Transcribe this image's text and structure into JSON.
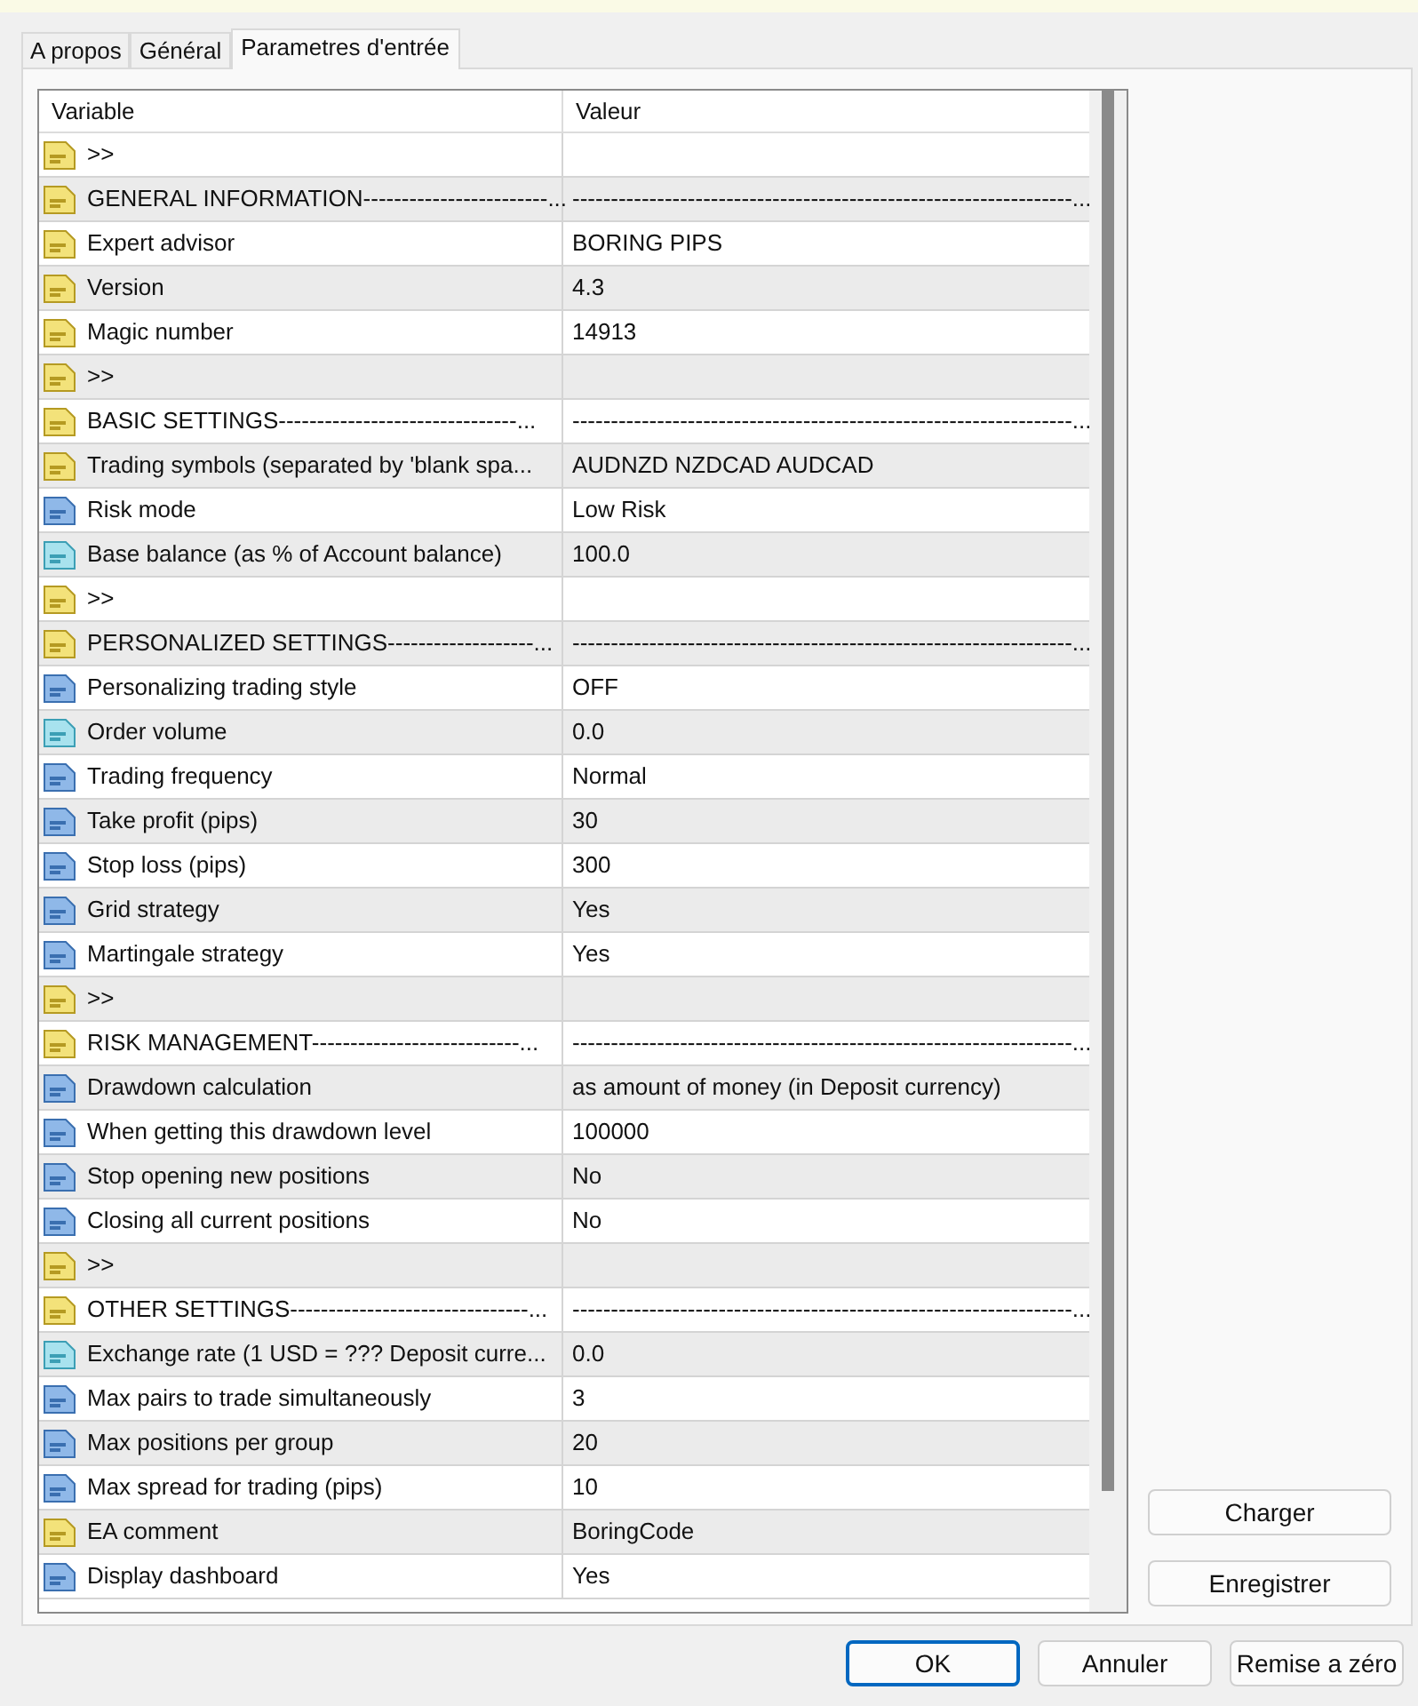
{
  "tabs": [
    {
      "label": "A propos",
      "selected": false
    },
    {
      "label": "Général",
      "selected": false
    },
    {
      "label": "Parametres d'entrée",
      "selected": true
    }
  ],
  "table": {
    "columns": [
      "Variable",
      "Valeur"
    ],
    "rows": [
      {
        "kind": "string",
        "variable": ">>"
      },
      {
        "kind": "string",
        "variable": "GENERAL INFORMATION------------------------...",
        "value": "-----------------------------------------------------------------..."
      },
      {
        "kind": "string",
        "variable": "Expert advisor",
        "value": "BORING PIPS"
      },
      {
        "kind": "string",
        "variable": "Version",
        "value": "4.3"
      },
      {
        "kind": "string",
        "variable": "Magic number",
        "value": "14913"
      },
      {
        "kind": "string",
        "variable": ">>"
      },
      {
        "kind": "string",
        "variable": "BASIC SETTINGS-------------------------------...",
        "value": "-----------------------------------------------------------------..."
      },
      {
        "kind": "string",
        "variable": "Trading symbols (separated by 'blank spa...",
        "value": "AUDNZD NZDCAD AUDCAD"
      },
      {
        "kind": "integer",
        "variable": "Risk mode",
        "value": "Low Risk"
      },
      {
        "kind": "double",
        "variable": "Base balance (as % of Account balance)",
        "value": "100.0"
      },
      {
        "kind": "string",
        "variable": ">>"
      },
      {
        "kind": "string",
        "variable": "PERSONALIZED SETTINGS-------------------...",
        "value": "-----------------------------------------------------------------..."
      },
      {
        "kind": "integer",
        "variable": "Personalizing trading style",
        "value": "OFF"
      },
      {
        "kind": "double",
        "variable": "Order volume",
        "value": "0.0"
      },
      {
        "kind": "integer",
        "variable": "Trading frequency",
        "value": "Normal"
      },
      {
        "kind": "integer",
        "variable": "Take profit (pips)",
        "value": "30"
      },
      {
        "kind": "integer",
        "variable": "Stop loss (pips)",
        "value": "300"
      },
      {
        "kind": "integer",
        "variable": "Grid strategy",
        "value": "Yes"
      },
      {
        "kind": "integer",
        "variable": "Martingale strategy",
        "value": "Yes"
      },
      {
        "kind": "string",
        "variable": ">>"
      },
      {
        "kind": "string",
        "variable": "RISK MANAGEMENT---------------------------...",
        "value": "-----------------------------------------------------------------..."
      },
      {
        "kind": "integer",
        "variable": "Drawdown calculation",
        "value": "as amount of money (in Deposit currency)"
      },
      {
        "kind": "integer",
        "variable": "When getting this drawdown level",
        "value": "100000"
      },
      {
        "kind": "integer",
        "variable": "Stop opening new positions",
        "value": "No"
      },
      {
        "kind": "integer",
        "variable": "Closing all current positions",
        "value": "No"
      },
      {
        "kind": "string",
        "variable": ">>"
      },
      {
        "kind": "string",
        "variable": "OTHER SETTINGS-------------------------------...",
        "value": "-----------------------------------------------------------------..."
      },
      {
        "kind": "double",
        "variable": "Exchange rate (1 USD = ??? Deposit curre...",
        "value": "0.0"
      },
      {
        "kind": "integer",
        "variable": "Max pairs to trade simultaneously",
        "value": "3"
      },
      {
        "kind": "integer",
        "variable": "Max positions per group",
        "value": "20"
      },
      {
        "kind": "integer",
        "variable": "Max spread for trading (pips)",
        "value": "10"
      },
      {
        "kind": "string",
        "variable": "EA comment",
        "value": "BoringCode"
      },
      {
        "kind": "integer",
        "variable": "Display dashboard",
        "value": "Yes"
      }
    ]
  },
  "side_buttons": [
    "Charger",
    "Enregistrer"
  ],
  "buttons": [
    {
      "label": "OK",
      "selected": true
    },
    {
      "label": "Annuler",
      "selected": false
    },
    {
      "label": "Remise a zéro",
      "selected": false
    }
  ]
}
